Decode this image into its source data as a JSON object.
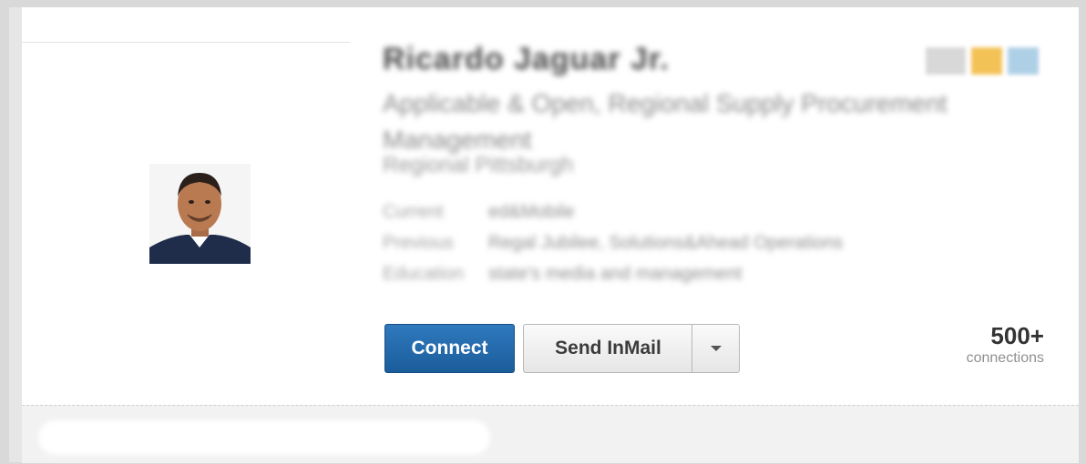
{
  "profile": {
    "name": "Ricardo Jaguar Jr.",
    "headline": "Applicable & Open, Regional Supply Procurement Management",
    "location": "Regional Pittsburgh",
    "details": [
      {
        "label": "Current",
        "value": "ed&Mobile"
      },
      {
        "label": "Previous",
        "value": "Regal Jubilee, Solutions&Ahead Operations"
      },
      {
        "label": "Education",
        "value": "state's media and management"
      }
    ]
  },
  "actions": {
    "connect_label": "Connect",
    "inmail_label": "Send InMail"
  },
  "connections": {
    "count": "500+",
    "label": "connections"
  },
  "icons": {
    "photo": "profile-photo",
    "dropdown": "caret-down-icon"
  },
  "colors": {
    "connect": "#1b5d9b",
    "badge_gold": "#f3c257",
    "badge_blue": "#aed0e6"
  }
}
